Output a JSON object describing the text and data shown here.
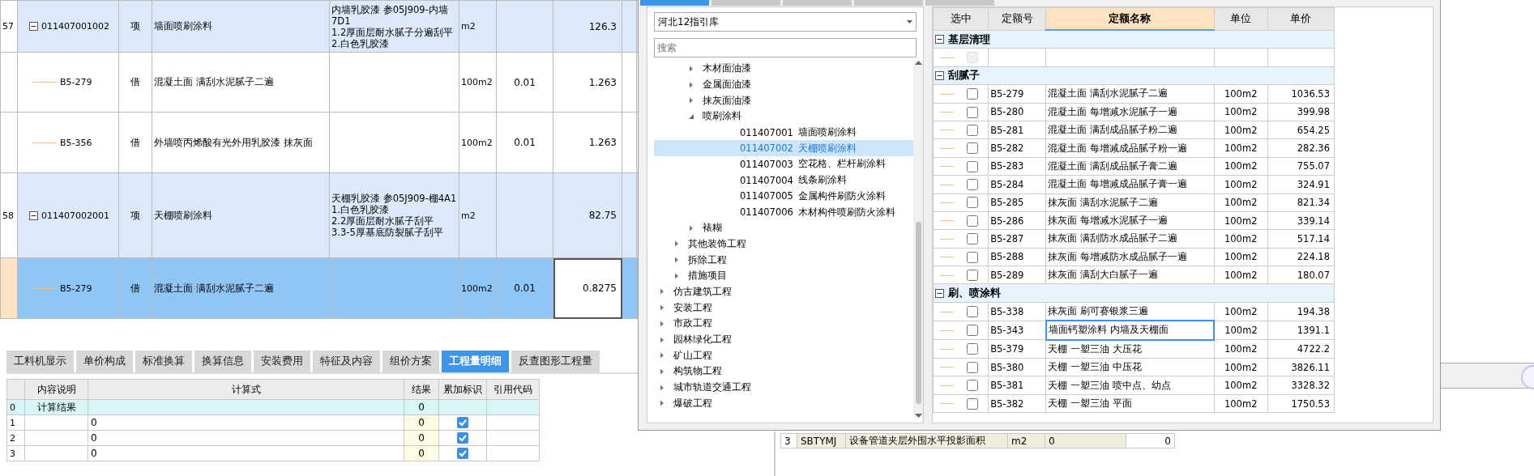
{
  "main_table": {
    "rows": [
      {
        "index": "57",
        "code": "011407001002",
        "kind": "item",
        "expanded": true,
        "selected": false,
        "type": "项",
        "name": "墙面喷刷涂料",
        "features": [
          "内墙乳胶漆 参05J909-内墙",
          "7D1",
          "1.2厚面层耐水腻子分遍刮平",
          "2.白色乳胶漆"
        ],
        "unit": "m2",
        "coefficient": "",
        "quantity": "126.3"
      },
      {
        "index": "",
        "code": "B5-279",
        "kind": "sub",
        "selected": false,
        "type": "借",
        "name": "混凝土面 满刮水泥腻子二遍",
        "features": [],
        "unit": "100m2",
        "coefficient": "0.01",
        "quantity": "1.263"
      },
      {
        "index": "",
        "code": "B5-356",
        "kind": "sub",
        "selected": false,
        "type": "借",
        "name": "外墙喷丙烯酸有光外用乳胶漆 抹灰面",
        "features": [],
        "unit": "100m2",
        "coefficient": "0.01",
        "quantity": "1.263"
      },
      {
        "index": "58",
        "code": "011407002001",
        "kind": "item",
        "expanded": true,
        "selected": false,
        "type": "项",
        "name": "天棚喷刷涂料",
        "features": [
          "天棚乳胶漆 参05J909-棚4A1",
          "1.白色乳胶漆",
          "2.2厚面层耐水腻子刮平",
          "3.3-5厚基底防裂腻子刮平"
        ],
        "unit": "m2",
        "coefficient": "",
        "quantity": "82.75"
      },
      {
        "index": "",
        "code": "B5-279",
        "kind": "sub",
        "selected": true,
        "type": "借",
        "name": "混凝土面 满刮水泥腻子二遍",
        "features": [],
        "unit": "100m2",
        "coefficient": "0.01",
        "quantity": "0.8275"
      }
    ]
  },
  "bottom_tabs": [
    {
      "label": "工料机显示",
      "selected": false
    },
    {
      "label": "单价构成",
      "selected": false
    },
    {
      "label": "标准换算",
      "selected": false
    },
    {
      "label": "换算信息",
      "selected": false
    },
    {
      "label": "安装费用",
      "selected": false
    },
    {
      "label": "特征及内容",
      "selected": false
    },
    {
      "label": "组价方案",
      "selected": false
    },
    {
      "label": "工程量明细",
      "selected": true
    },
    {
      "label": "反查图形工程量",
      "selected": false
    }
  ],
  "detail_grid": {
    "columns": [
      "内容说明",
      "计算式",
      "结果",
      "累加标识",
      "引用代码"
    ],
    "rows": [
      {
        "index": "0",
        "kind": "total",
        "description": "计算结果",
        "formula": "",
        "result": "0"
      },
      {
        "index": "1",
        "kind": "line",
        "description": "",
        "formula": "0",
        "result": "0",
        "accumulate": true
      },
      {
        "index": "2",
        "kind": "line",
        "description": "",
        "formula": "0",
        "result": "0",
        "accumulate": true
      },
      {
        "index": "3",
        "kind": "line",
        "description": "",
        "formula": "0",
        "result": "0",
        "accumulate": true
      }
    ]
  },
  "background_table": {
    "rows": [
      {
        "index": "3",
        "code": "SBTYMJ",
        "name": "设备管道夹层外围水平投影面积",
        "unit": "m2",
        "expression": "0",
        "value": "0"
      }
    ]
  },
  "dialog": {
    "tabs": [
      {
        "selected": true
      },
      {
        "selected": false
      },
      {
        "selected": false
      },
      {
        "selected": false
      },
      {
        "selected": false
      }
    ],
    "library": "河北12指引库",
    "search": {
      "placeholder": "搜索"
    },
    "tree": [
      {
        "children": [
          {
            "children": [
              {
                "label": "木材面油漆",
                "expanded": false
              },
              {
                "label": "金属面油漆",
                "expanded": false
              },
              {
                "label": "抹灰面油漆",
                "expanded": false
              },
              {
                "label": "喷刷涂料",
                "expanded": true,
                "children": [
                  {
                    "code": "011407001",
                    "label": "墙面喷刷涂料",
                    "selected": false
                  },
                  {
                    "code": "011407002",
                    "label": "天棚喷刷涂料",
                    "selected": true
                  },
                  {
                    "code": "011407003",
                    "label": "空花格、栏杆刷涂料",
                    "selected": false
                  },
                  {
                    "code": "011407004",
                    "label": "线条刷涂料",
                    "selected": false
                  },
                  {
                    "code": "011407005",
                    "label": "金属构件刷防火涂料",
                    "selected": false
                  },
                  {
                    "code": "011407006",
                    "label": "木材构件喷刷防火涂料",
                    "selected": false
                  }
                ]
              },
              {
                "label": "裱糊",
                "expanded": false
              }
            ]
          },
          {
            "label": "其他装饰工程",
            "expanded": false
          },
          {
            "label": "拆除工程",
            "expanded": false
          },
          {
            "label": "措施项目",
            "expanded": false
          }
        ]
      },
      {
        "label": "仿古建筑工程",
        "expanded": false
      },
      {
        "label": "安装工程",
        "expanded": false
      },
      {
        "label": "市政工程",
        "expanded": false
      },
      {
        "label": "园林绿化工程",
        "expanded": false
      },
      {
        "label": "矿山工程",
        "expanded": false
      },
      {
        "label": "构筑物工程",
        "expanded": false
      },
      {
        "label": "城市轨道交通工程",
        "expanded": false
      },
      {
        "label": "爆破工程",
        "expanded": false
      }
    ],
    "quota_table": {
      "columns": [
        {
          "label": "选中",
          "highlighted": false
        },
        {
          "label": "定额号",
          "highlighted": false
        },
        {
          "label": "定额名称",
          "highlighted": true
        },
        {
          "label": "单位",
          "highlighted": false
        },
        {
          "label": "单价",
          "highlighted": false
        }
      ],
      "groups": [
        {
          "name": "基层清理",
          "expanded": true,
          "rows": [
            {
              "code": "",
              "name": "",
              "unit": "",
              "price": "",
              "checked": false,
              "disabled": true,
              "focused": false
            }
          ]
        },
        {
          "name": "刮腻子",
          "expanded": true,
          "rows": [
            {
              "code": "B5-279",
              "name": "混凝土面 满刮水泥腻子二遍",
              "unit": "100m2",
              "price": "1036.53",
              "checked": false,
              "disabled": false,
              "focused": false
            },
            {
              "code": "B5-280",
              "name": "混凝土面 每增减水泥腻子一遍",
              "unit": "100m2",
              "price": "399.98",
              "checked": false,
              "disabled": false,
              "focused": false
            },
            {
              "code": "B5-281",
              "name": "混凝土面 满刮成品腻子粉二遍",
              "unit": "100m2",
              "price": "654.25",
              "checked": false,
              "disabled": false,
              "focused": false
            },
            {
              "code": "B5-282",
              "name": "混凝土面 每增减成品腻子粉一遍",
              "unit": "100m2",
              "price": "282.36",
              "checked": false,
              "disabled": false,
              "focused": false
            },
            {
              "code": "B5-283",
              "name": "混凝土面 满刮成品腻子膏二遍",
              "unit": "100m2",
              "price": "755.07",
              "checked": false,
              "disabled": false,
              "focused": false
            },
            {
              "code": "B5-284",
              "name": "混凝土面 每增减成品腻子膏一遍",
              "unit": "100m2",
              "price": "324.91",
              "checked": false,
              "disabled": false,
              "focused": false
            },
            {
              "code": "B5-285",
              "name": "抹灰面 满刮水泥腻子二遍",
              "unit": "100m2",
              "price": "821.34",
              "checked": false,
              "disabled": false,
              "focused": false
            },
            {
              "code": "B5-286",
              "name": "抹灰面 每增减水泥腻子一遍",
              "unit": "100m2",
              "price": "339.14",
              "checked": false,
              "disabled": false,
              "focused": false
            },
            {
              "code": "B5-287",
              "name": "抹灰面 满刮防水成品腻子二遍",
              "unit": "100m2",
              "price": "517.14",
              "checked": false,
              "disabled": false,
              "focused": false
            },
            {
              "code": "B5-288",
              "name": "抹灰面 每增减防水成品腻子一遍",
              "unit": "100m2",
              "price": "224.18",
              "checked": false,
              "disabled": false,
              "focused": false
            },
            {
              "code": "B5-289",
              "name": "抹灰面 满刮大白腻子一遍",
              "unit": "100m2",
              "price": "180.07",
              "checked": false,
              "disabled": false,
              "focused": false
            }
          ]
        },
        {
          "name": "刷、喷涂料",
          "expanded": true,
          "rows": [
            {
              "code": "B5-338",
              "name": "抹灰面 刷可赛银浆三遍",
              "unit": "100m2",
              "price": "194.38",
              "checked": false,
              "disabled": false,
              "focused": false
            },
            {
              "code": "B5-343",
              "name": "墙面钙塑涂料 内墙及天棚面",
              "unit": "100m2",
              "price": "1391.1",
              "checked": false,
              "disabled": false,
              "focused": true
            },
            {
              "code": "B5-379",
              "name": "天棚 一塑三油 大压花",
              "unit": "100m2",
              "price": "4722.2",
              "checked": false,
              "disabled": false,
              "focused": false
            },
            {
              "code": "B5-380",
              "name": "天棚 一塑三油 中压花",
              "unit": "100m2",
              "price": "3826.11",
              "checked": false,
              "disabled": false,
              "focused": false
            },
            {
              "code": "B5-381",
              "name": "天棚 一塑三油 喷中点、幼点",
              "unit": "100m2",
              "price": "3328.32",
              "checked": false,
              "disabled": false,
              "focused": false
            },
            {
              "code": "B5-382",
              "name": "天棚 一塑三油 平面",
              "unit": "100m2",
              "price": "1750.53",
              "checked": false,
              "disabled": false,
              "focused": false
            }
          ]
        }
      ]
    }
  }
}
